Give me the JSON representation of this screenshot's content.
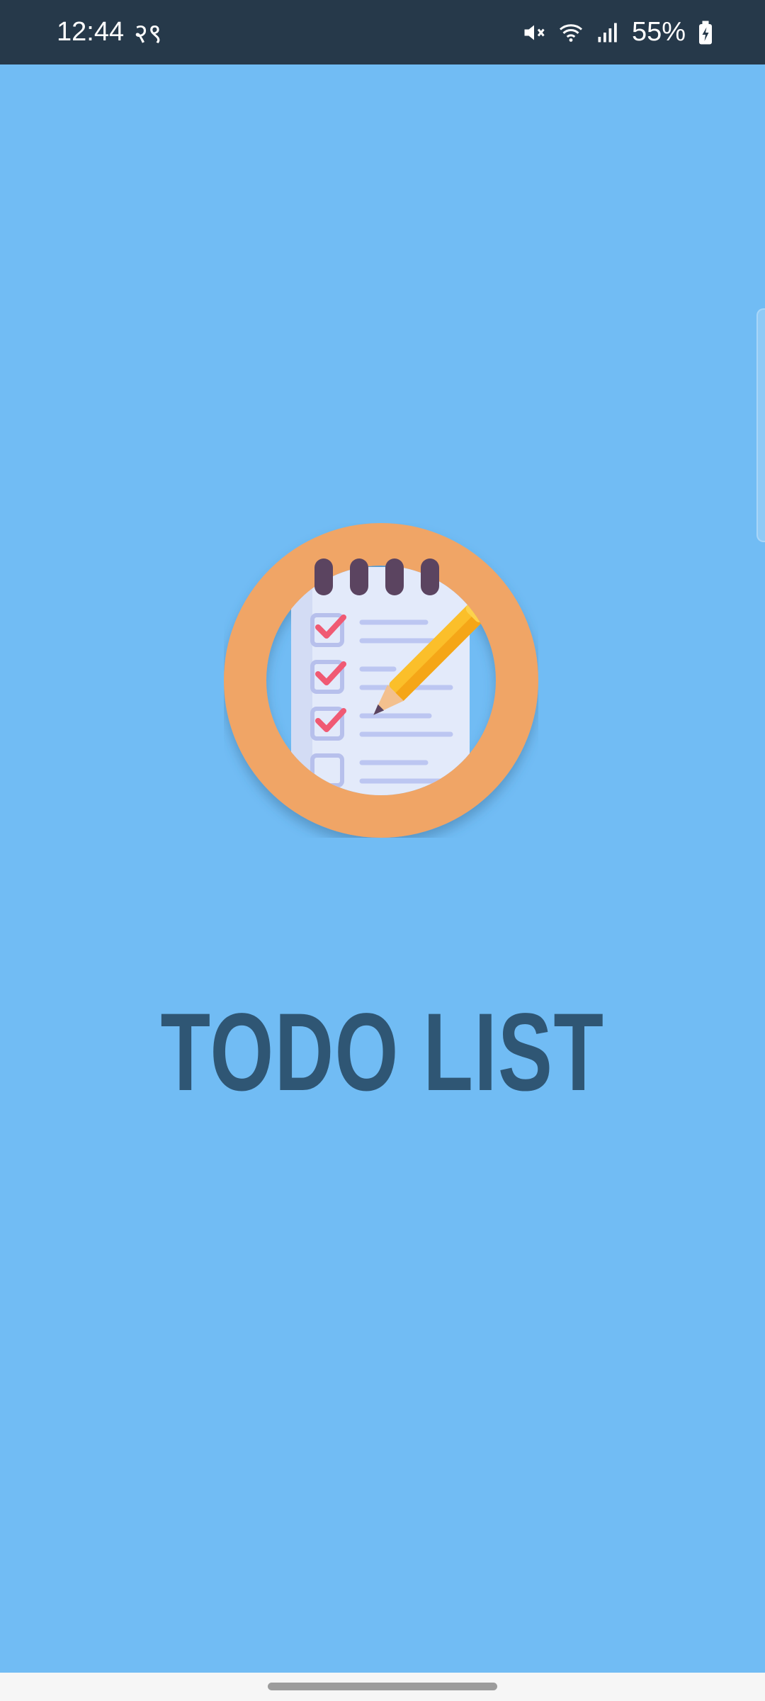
{
  "status_bar": {
    "time": "12:44",
    "extra_indicator": "२९",
    "battery": "55%",
    "icons": [
      "mute-icon",
      "wifi-icon",
      "signal-icon",
      "battery-icon"
    ]
  },
  "app": {
    "title": "TODO LIST",
    "logo_icon": "todo-checklist-pencil-icon"
  },
  "colors": {
    "background": "#71bcf4",
    "status_bar": "#26394a",
    "title": "#2f5674",
    "logo_ring": "#f0a566",
    "nav_bar": "#f6f6f6"
  }
}
